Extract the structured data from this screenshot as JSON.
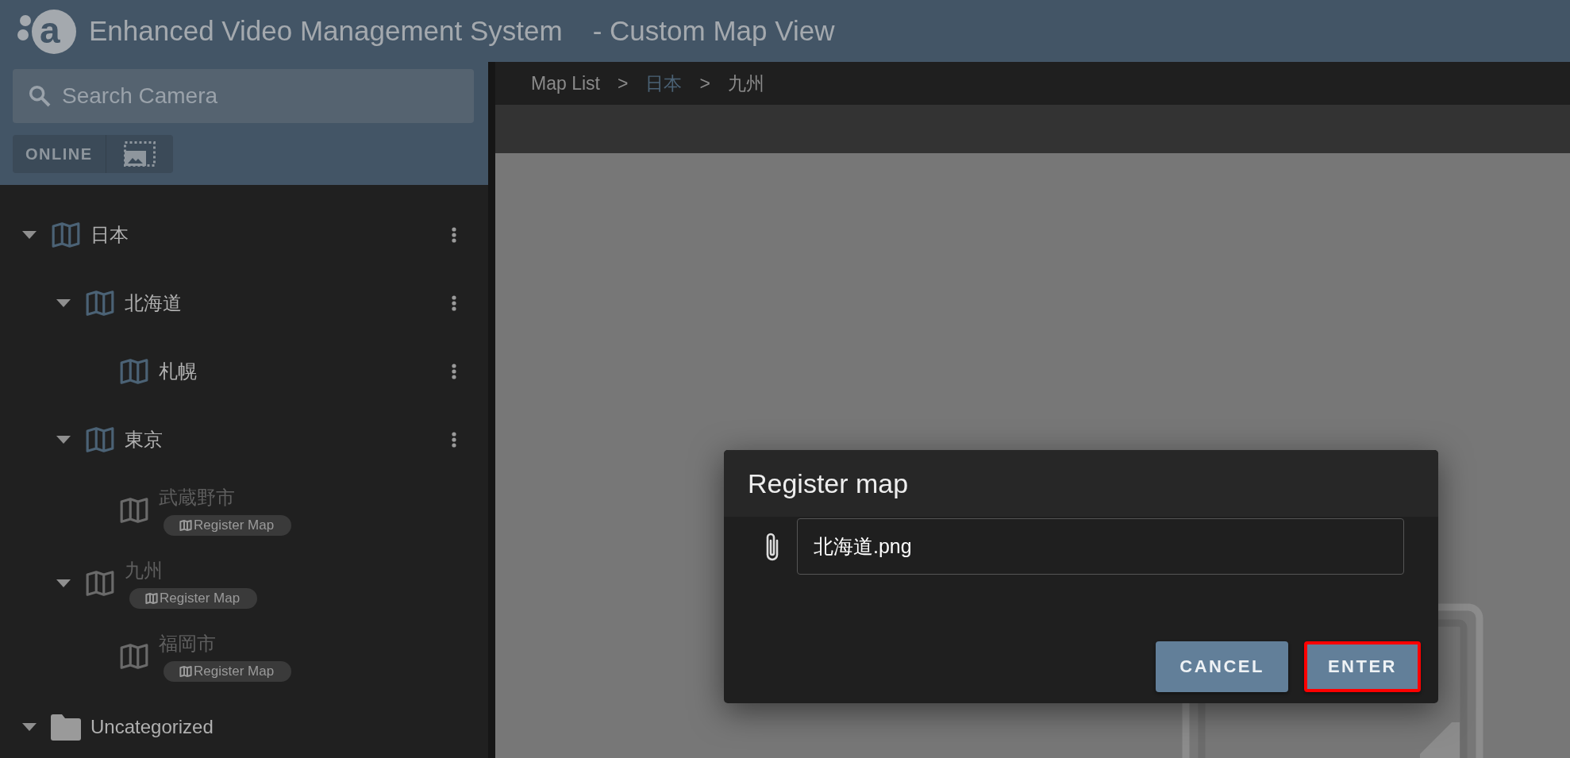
{
  "header": {
    "logo_letter": "a",
    "title": "Enhanced Video Management System",
    "subtitle": "- Custom Map View"
  },
  "sidebar": {
    "search": {
      "placeholder": "Search Camera"
    },
    "filter_label": "ONLINE",
    "tree": [
      {
        "kind": "map",
        "label": "日本",
        "registered": true,
        "expanded": true,
        "children": [
          {
            "kind": "map",
            "label": "北海道",
            "registered": true,
            "expanded": true,
            "children": [
              {
                "kind": "map",
                "label": "札幌",
                "registered": true
              }
            ]
          },
          {
            "kind": "map",
            "label": "東京",
            "registered": true,
            "expanded": true,
            "children": [
              {
                "kind": "map",
                "label": "武蔵野市",
                "registered": false,
                "badge": "Register Map"
              }
            ]
          },
          {
            "kind": "map",
            "label": "九州",
            "registered": false,
            "badge": "Register Map",
            "expanded": true,
            "children": [
              {
                "kind": "map",
                "label": "福岡市",
                "registered": false,
                "badge": "Register Map"
              }
            ]
          }
        ]
      },
      {
        "kind": "folder",
        "label": "Uncategorized",
        "registered": true,
        "expanded": true
      }
    ]
  },
  "breadcrumb": [
    {
      "label": "Map List",
      "link": false
    },
    {
      "label": ">",
      "link": false
    },
    {
      "label": "日本",
      "link": true
    },
    {
      "label": ">",
      "link": false
    },
    {
      "label": "九州",
      "link": false
    }
  ],
  "dialog": {
    "title": "Register map",
    "file_value": "北海道.png",
    "buttons": [
      {
        "label": "CANCEL",
        "highlighted": false
      },
      {
        "label": "ENTER",
        "highlighted": true
      }
    ]
  }
}
